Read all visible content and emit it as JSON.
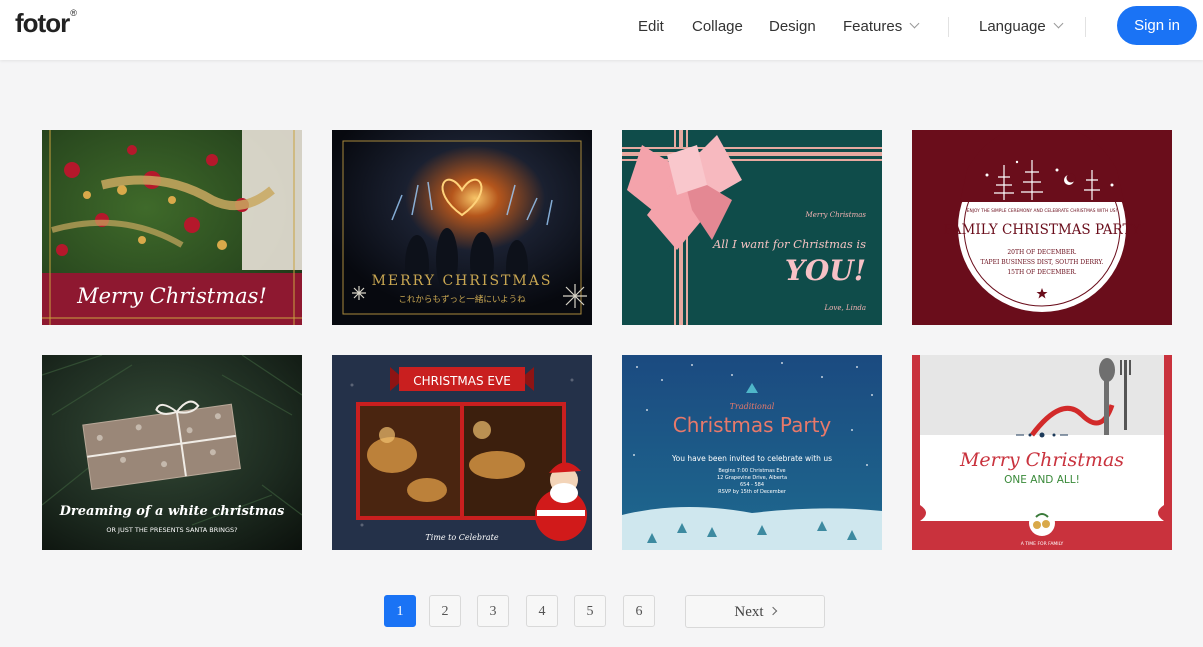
{
  "header": {
    "logo": "fotor",
    "logo_mark": "®",
    "nav": {
      "edit": "Edit",
      "collage": "Collage",
      "design": "Design",
      "features": "Features",
      "language": "Language"
    },
    "signin_label": "Sign in",
    "accent_color": "#1a73f5"
  },
  "cards": [
    {
      "text": "Merry Christmas!"
    },
    {
      "text": "MERRY CHRISTMAS",
      "subtext": "これからもずっと一緒にいようね"
    },
    {
      "small": "Merry Christmas",
      "line1": "All I want for Christmas is",
      "big": "YOU!",
      "sign": "Love, Linda"
    },
    {
      "top": "ENJOY THE SIMPLE CEREMONY AND CELEBRATE CHRISTMAS WITH US!",
      "title": "FAMILY CHRISTMAS PARTY",
      "date": "20TH OF DECEMBER.",
      "addr": "TAPEI BUSINESS DIST, SOUTH DERRY.",
      "rsvp": "15TH OF DECEMBER."
    },
    {
      "text": "Dreaming of a white christmas",
      "sub": "OR JUST THE PRESENTS SANTA BRINGS?"
    },
    {
      "banner": "CHRISTMAS EVE",
      "foot": "Time to Celebrate"
    },
    {
      "small": "Traditional",
      "title": "Christmas Party",
      "invite": "You have been invited to celebrate with us",
      "d1": "Begins 7:00 Christmas Eve",
      "d2": "12 Grapevine Drive, Alberta",
      "d3": "654 - 584",
      "d4": "RSVP by 15th of December"
    },
    {
      "title": "Merry Christmas",
      "sub": "ONE AND ALL!",
      "foot": "A TIME FOR FAMILY"
    }
  ],
  "pagination": {
    "pages": [
      "1",
      "2",
      "3",
      "4",
      "5",
      "6"
    ],
    "current": "1",
    "next_label": "Next"
  }
}
